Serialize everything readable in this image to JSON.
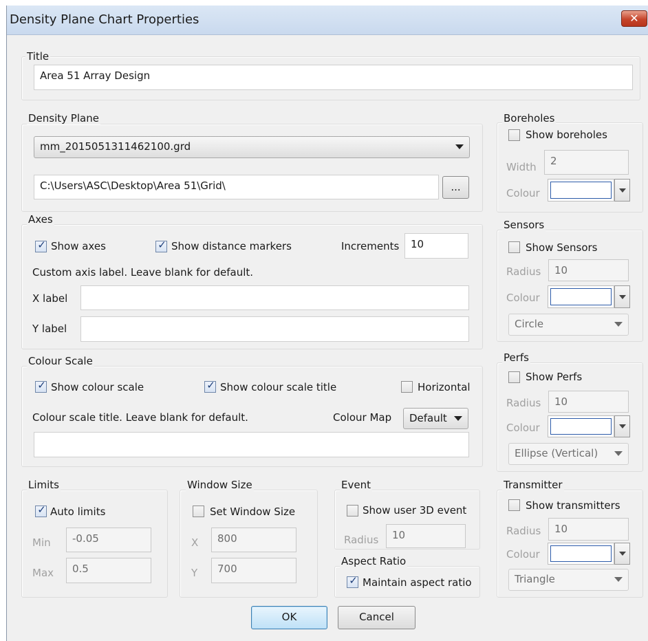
{
  "window": {
    "title": "Density Plane Chart Properties",
    "close_glyph": "✕"
  },
  "title_group": {
    "legend": "Title",
    "value": "Area 51 Array Design"
  },
  "density_plane": {
    "legend": "Density Plane",
    "file_selected": "mm_2015051311462100.grd",
    "path_value": "C:\\Users\\ASC\\Desktop\\Area 51\\Grid\\",
    "browse_label": "..."
  },
  "axes": {
    "legend": "Axes",
    "show_axes": {
      "label": "Show axes",
      "checked": true
    },
    "show_distance_markers": {
      "label": "Show distance markers",
      "checked": true
    },
    "increments_label": "Increments",
    "increments_value": "10",
    "custom_label_note": "Custom axis label.  Leave blank for default.",
    "x_label": "X label",
    "x_value": "",
    "y_label": "Y label",
    "y_value": ""
  },
  "colour_scale": {
    "legend": "Colour Scale",
    "show_colour_scale": {
      "label": "Show colour scale",
      "checked": true
    },
    "show_colour_scale_title": {
      "label": "Show colour scale title",
      "checked": true
    },
    "horizontal": {
      "label": "Horizontal",
      "checked": false
    },
    "title_note": "Colour scale title. Leave blank for default.",
    "colour_map_label": "Colour Map",
    "colour_map_value": "Default",
    "title_value": ""
  },
  "limits": {
    "legend": "Limits",
    "auto_limits": {
      "label": "Auto limits",
      "checked": true
    },
    "min_label": "Min",
    "min_value": "-0.05",
    "max_label": "Max",
    "max_value": "0.5"
  },
  "window_size": {
    "legend": "Window Size",
    "set_window_size": {
      "label": "Set Window Size",
      "checked": false
    },
    "x_label": "X",
    "x_value": "800",
    "y_label": "Y",
    "y_value": "700"
  },
  "event": {
    "legend": "Event",
    "show_user_3d_event": {
      "label": "Show user 3D event",
      "checked": false
    },
    "radius_label": "Radius",
    "radius_value": "10"
  },
  "aspect_ratio": {
    "legend": "Aspect Ratio",
    "maintain": {
      "label": "Maintain aspect ratio",
      "checked": true
    }
  },
  "boreholes": {
    "legend": "Boreholes",
    "show": {
      "label": "Show boreholes",
      "checked": false
    },
    "width_label": "Width",
    "width_value": "2",
    "colour_label": "Colour"
  },
  "sensors": {
    "legend": "Sensors",
    "show": {
      "label": "Show Sensors",
      "checked": false
    },
    "radius_label": "Radius",
    "radius_value": "10",
    "colour_label": "Colour",
    "shape_value": "Circle"
  },
  "perfs": {
    "legend": "Perfs",
    "show": {
      "label": "Show Perfs",
      "checked": false
    },
    "radius_label": "Radius",
    "radius_value": "10",
    "colour_label": "Colour",
    "shape_value": "Ellipse (Vertical)"
  },
  "transmitter": {
    "legend": "Transmitter",
    "show": {
      "label": "Show transmitters",
      "checked": false
    },
    "radius_label": "Radius",
    "radius_value": "10",
    "colour_label": "Colour",
    "shape_value": "Triangle"
  },
  "buttons": {
    "ok_label": "OK",
    "cancel_label": "Cancel"
  },
  "colors": {
    "accent": "#3c7fb1",
    "titlebar": "#c9d9ee",
    "close": "#c6452b"
  }
}
